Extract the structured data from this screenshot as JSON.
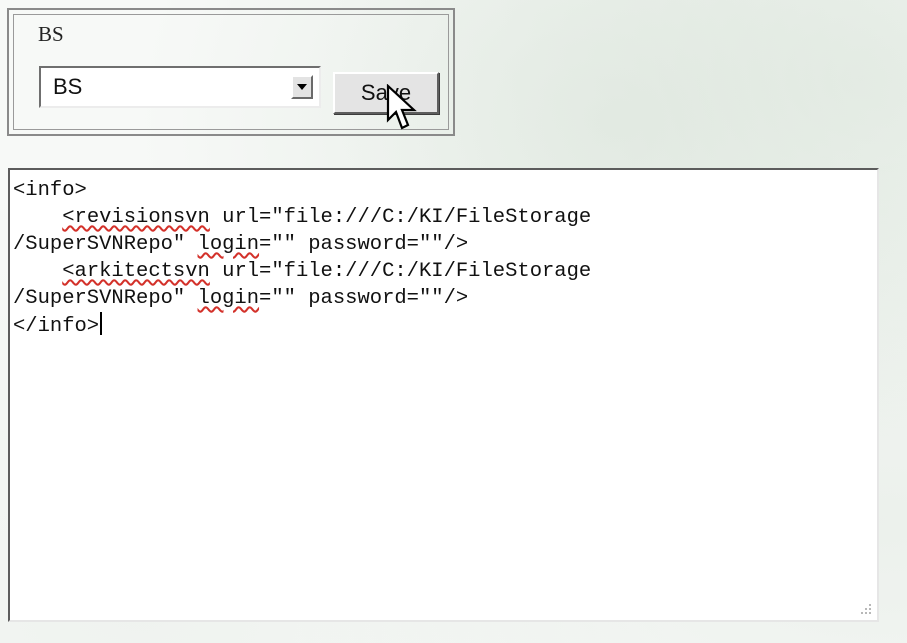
{
  "group": {
    "label": "BS"
  },
  "select": {
    "value": "BS"
  },
  "buttons": {
    "save_label": "Save"
  },
  "editor": {
    "lines": [
      [
        {
          "t": "<info>"
        }
      ],
      [
        {
          "t": "    "
        },
        {
          "t": "<revisionsvn",
          "spell": true
        },
        {
          "t": " url=\"file:///C:/KI/FileStorage"
        }
      ],
      [
        {
          "t": "/SuperSVNRepo\" "
        },
        {
          "t": "login",
          "spell": true
        },
        {
          "t": "=\"\" password=\"\"/>"
        }
      ],
      [
        {
          "t": "    "
        },
        {
          "t": "<arkitectsvn",
          "spell": true
        },
        {
          "t": " url=\"file:///C:/KI/FileStorage"
        }
      ],
      [
        {
          "t": "/SuperSVNRepo\" "
        },
        {
          "t": "login",
          "spell": true
        },
        {
          "t": "=\"\" password=\"\"/>"
        }
      ],
      [
        {
          "t": "</info>"
        }
      ]
    ]
  },
  "icons": {
    "cursor": "mouse-pointer-icon",
    "dropdown": "dropdown-arrow-icon",
    "grip": "resize-grip-icon"
  },
  "colors": {
    "spellcheck_underline": "#d3312a",
    "button_face": "#e4e4e4"
  }
}
